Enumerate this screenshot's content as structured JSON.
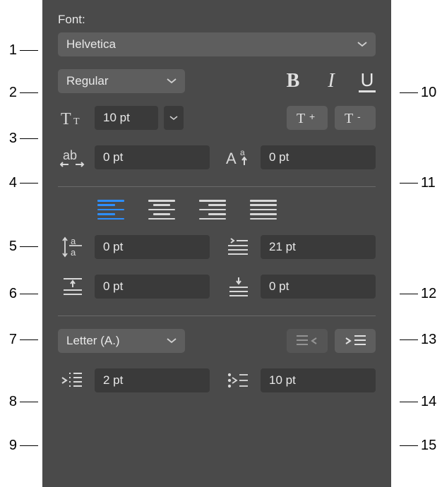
{
  "labels": {
    "font": "Font:"
  },
  "font": {
    "family": "Helvetica",
    "style": "Regular",
    "size": "10 pt",
    "tracking": "0 pt",
    "baseline": "0 pt"
  },
  "paragraph": {
    "line_spacing": "0 pt",
    "first_line_indent": "21 pt",
    "space_before": "0 pt",
    "space_after": "0 pt",
    "list_format": "Letter (A.)",
    "text_inset": "2 pt",
    "marker_inset": "10 pt"
  },
  "callouts": {
    "c1": "1",
    "c2": "2",
    "c3": "3",
    "c4": "4",
    "c5": "5",
    "c6": "6",
    "c7": "7",
    "c8": "8",
    "c9": "9",
    "c10": "10",
    "c11": "11",
    "c12": "12",
    "c13": "13",
    "c14": "14",
    "c15": "15"
  }
}
